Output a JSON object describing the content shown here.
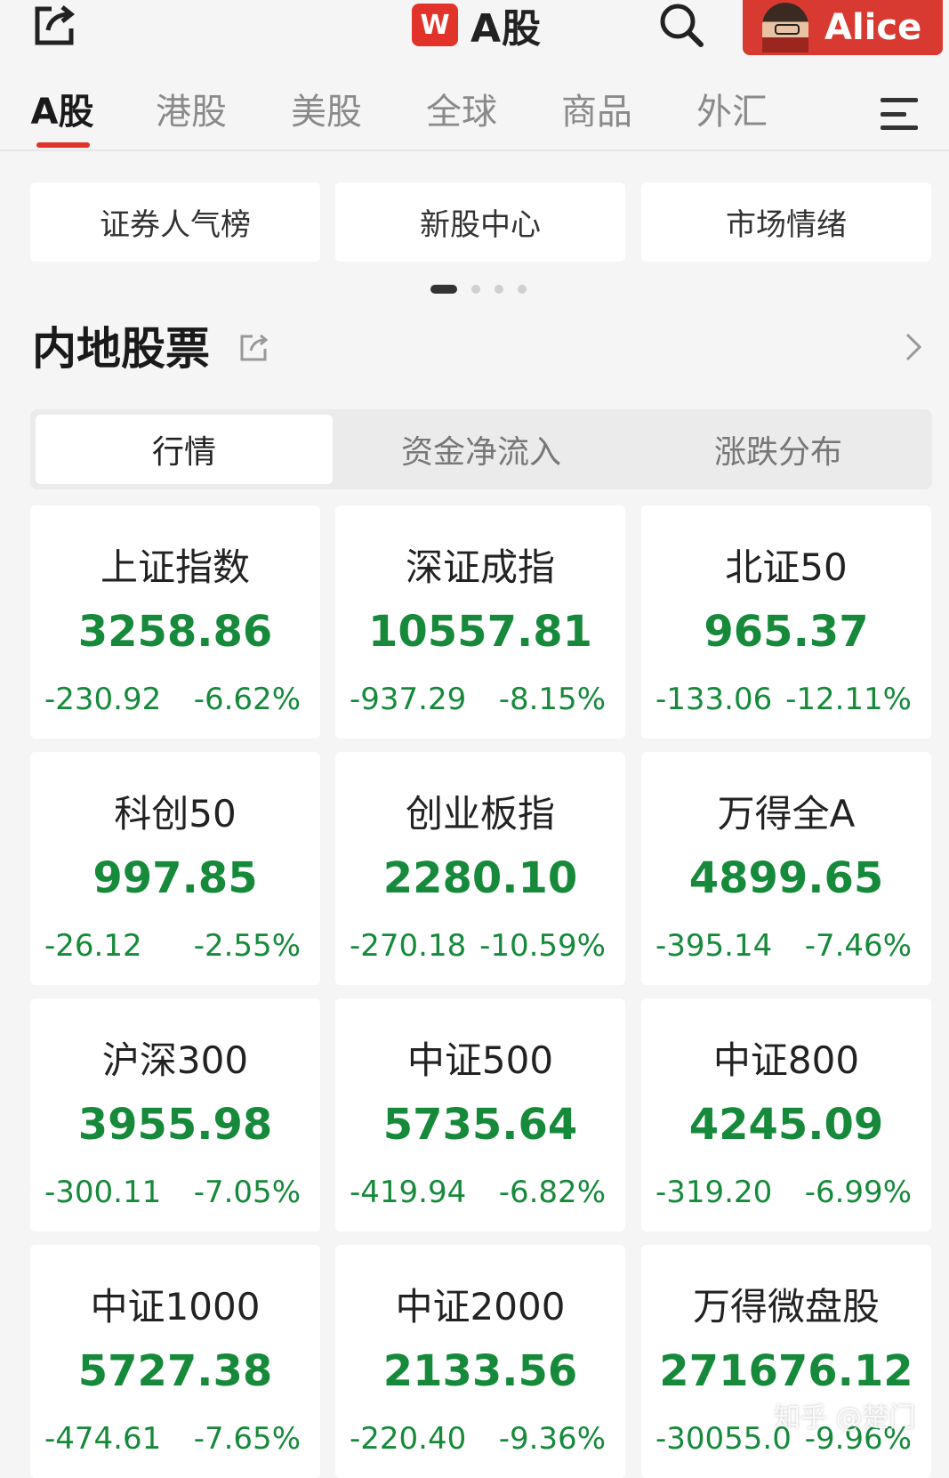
{
  "header": {
    "brand_logo_text": "W",
    "title": "A股",
    "user_name": "Alice"
  },
  "tabs": [
    {
      "label": "A股",
      "active": true
    },
    {
      "label": "港股",
      "active": false
    },
    {
      "label": "美股",
      "active": false
    },
    {
      "label": "全球",
      "active": false
    },
    {
      "label": "商品",
      "active": false
    },
    {
      "label": "外汇",
      "active": false
    }
  ],
  "shortcuts": [
    "证券人气榜",
    "新股中心",
    "市场情绪"
  ],
  "pager": {
    "pages": 4,
    "current": 1
  },
  "section": {
    "title": "内地股票"
  },
  "segments": [
    {
      "label": "行情",
      "active": true
    },
    {
      "label": "资金净流入",
      "active": false
    },
    {
      "label": "涨跌分布",
      "active": false
    }
  ],
  "indices": [
    {
      "name": "上证指数",
      "value": "3258.86",
      "change": "-230.92",
      "pct": "-6.62%"
    },
    {
      "name": "深证成指",
      "value": "10557.81",
      "change": "-937.29",
      "pct": "-8.15%"
    },
    {
      "name": "北证50",
      "value": "965.37",
      "change": "-133.06",
      "pct": "-12.11%"
    },
    {
      "name": "科创50",
      "value": "997.85",
      "change": "-26.12",
      "pct": "-2.55%"
    },
    {
      "name": "创业板指",
      "value": "2280.10",
      "change": "-270.18",
      "pct": "-10.59%"
    },
    {
      "name": "万得全A",
      "value": "4899.65",
      "change": "-395.14",
      "pct": "-7.46%"
    },
    {
      "name": "沪深300",
      "value": "3955.98",
      "change": "-300.11",
      "pct": "-7.05%"
    },
    {
      "name": "中证500",
      "value": "5735.64",
      "change": "-419.94",
      "pct": "-6.82%"
    },
    {
      "name": "中证800",
      "value": "4245.09",
      "change": "-319.20",
      "pct": "-6.99%"
    },
    {
      "name": "中证1000",
      "value": "5727.38",
      "change": "-474.61",
      "pct": "-7.65%"
    },
    {
      "name": "中证2000",
      "value": "2133.56",
      "change": "-220.40",
      "pct": "-9.36%"
    },
    {
      "name": "万得微盘股",
      "value": "271676.12",
      "change": "-30055.0",
      "pct": "-9.96%"
    }
  ],
  "colors": {
    "brand_red": "#e2332b",
    "down_green": "#168a3a"
  },
  "watermark": "知乎 @楚门"
}
